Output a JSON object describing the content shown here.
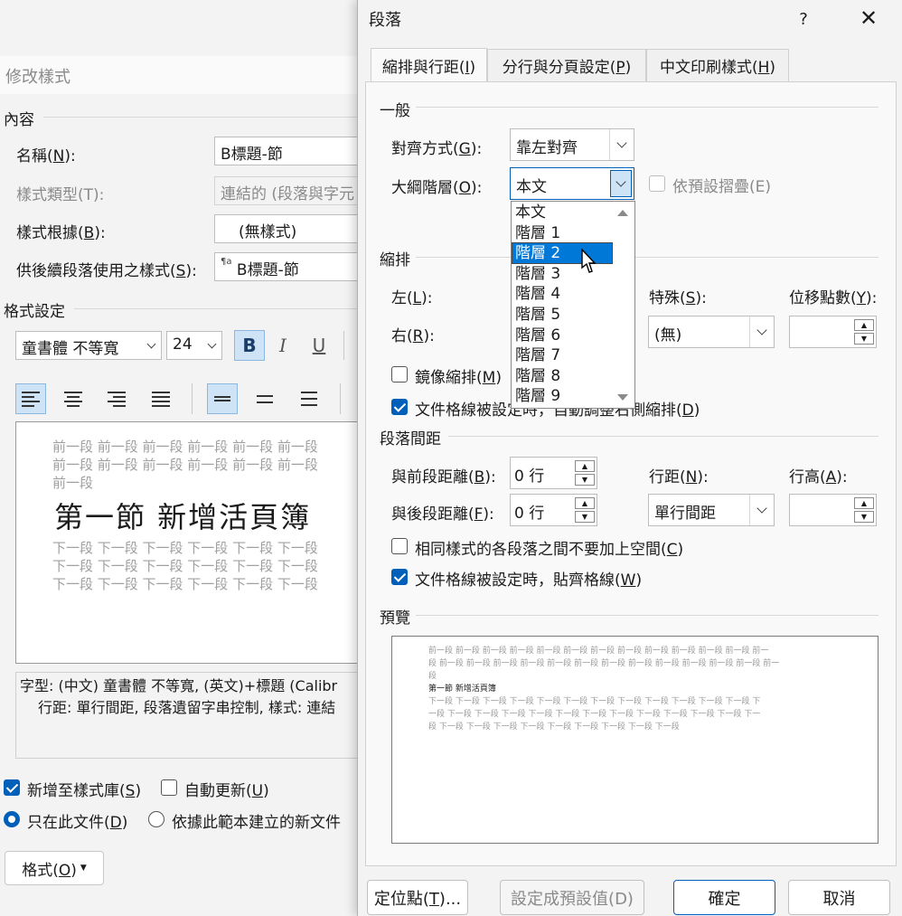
{
  "background_dialog": {
    "title": "修改樣式",
    "section_properties": "內容",
    "name_label": "名稱(N):",
    "name_value": "B標題-節",
    "style_type_label": "樣式類型(T):",
    "style_type_value": "連結的 (段落與字元",
    "style_based_on_label": "樣式根據(B):",
    "style_based_on_value": "(無樣式)",
    "next_style_label": "供後續段落使用之樣式(S):",
    "next_style_value": "B標題-節",
    "section_formatting": "格式設定",
    "font_name": "童書體 不等寬",
    "font_size": "24",
    "bold_label": "B",
    "italic_label": "I",
    "underline_label": "U",
    "preview_prev_line1": "前一段 前一段 前一段 前一段 前一段 前一段",
    "preview_prev_line2": "前一段 前一段 前一段 前一段 前一段 前一段",
    "preview_prev_line3": "前一段",
    "preview_sample": "第一節 新增活頁簿",
    "preview_next_line1": "下一段 下一段 下一段 下一段 下一段 下一段",
    "preview_next_line2": "下一段 下一段 下一段 下一段 下一段 下一段",
    "preview_next_line3": "下一段 下一段 下一段 下一段 下一段 下一段",
    "description_line1": "字型: (中文) 童書體 不等寬, (英文)+標題 (Calibr",
    "description_line2": "行距:  單行間距, 段落遺留字串控制, 樣式: 連結",
    "add_to_gallery_label": "新增至樣式庫(S)",
    "add_to_gallery_checked": true,
    "auto_update_label": "自動更新(U)",
    "auto_update_checked": false,
    "only_this_doc_label": "只在此文件(D)",
    "new_docs_label": "依據此範本建立的新文件",
    "format_button": "格式(O)"
  },
  "dialog": {
    "title": "段落",
    "help": "?",
    "close": "✕",
    "tabs": [
      {
        "label": "縮排與行距(I)",
        "active": true
      },
      {
        "label": "分行與分頁設定(P)",
        "active": false
      },
      {
        "label": "中文印刷樣式(H)",
        "active": false
      }
    ],
    "general": {
      "section": "一般",
      "alignment_label": "對齊方式(G):",
      "alignment_value": "靠左對齊",
      "outline_label": "大綱階層(O):",
      "outline_value": "本文",
      "collapsed_label": "依預設摺疊(E)",
      "collapsed_checked": false
    },
    "outline_options": [
      "本文",
      "階層 1",
      "階層 2",
      "階層 3",
      "階層 4",
      "階層 5",
      "階層 6",
      "階層 7",
      "階層 8",
      "階層 9"
    ],
    "outline_highlighted": "階層 2",
    "indent": {
      "section": "縮排",
      "left_label": "左(L):",
      "right_label": "右(R):",
      "special_label": "特殊(S):",
      "special_value": "(無)",
      "by_label": "位移點數(Y):",
      "by_value": "",
      "mirror_label": "鏡像縮排(M)",
      "mirror_checked": false,
      "auto_adjust_label": "文件格線被設定時，自動調整右側縮排(D)",
      "auto_adjust_checked": true
    },
    "spacing": {
      "section": "段落間距",
      "before_label": "與前段距離(B):",
      "before_value": "0 行",
      "after_label": "與後段距離(F):",
      "after_value": "0 行",
      "line_spacing_label": "行距(N):",
      "line_spacing_value": "單行間距",
      "at_label": "行高(A):",
      "at_value": "",
      "no_space_label": "相同樣式的各段落之間不要加上空間(C)",
      "no_space_checked": false,
      "snap_grid_label": "文件格線被設定時，貼齊格線(W)",
      "snap_grid_checked": true
    },
    "preview": {
      "section": "預覽",
      "prev_line1": "前一段 前一段 前一段 前一段 前一段 前一段 前一段 前一段 前一段 前一段 前一段 前一段 前一",
      "prev_line2": "段 前一段 前一段 前一段 前一段 前一段 前一段 前一段 前一段 前一段 前一段 前一段 前一段 前一",
      "prev_line3": "段",
      "sample": "第一節 新增活頁簿",
      "next_line1": "下一段 下一段 下一段 下一段 下一段 下一段 下一段 下一段 下一段 下一段 下一段 下一段 下",
      "next_line2": "一段 下一段 下一段 下一段 下一段 下一段 下一段 下一段 下一段 下一段 下一段 下一段 下一",
      "next_line3": "段 下一段 下一段 下一段 下一段 下一段 下一段 下一段 下一段 下一段"
    },
    "buttons": {
      "tabs": "定位點(T)...",
      "set_default": "設定成預設值(D)",
      "ok": "確定",
      "cancel": "取消"
    }
  }
}
